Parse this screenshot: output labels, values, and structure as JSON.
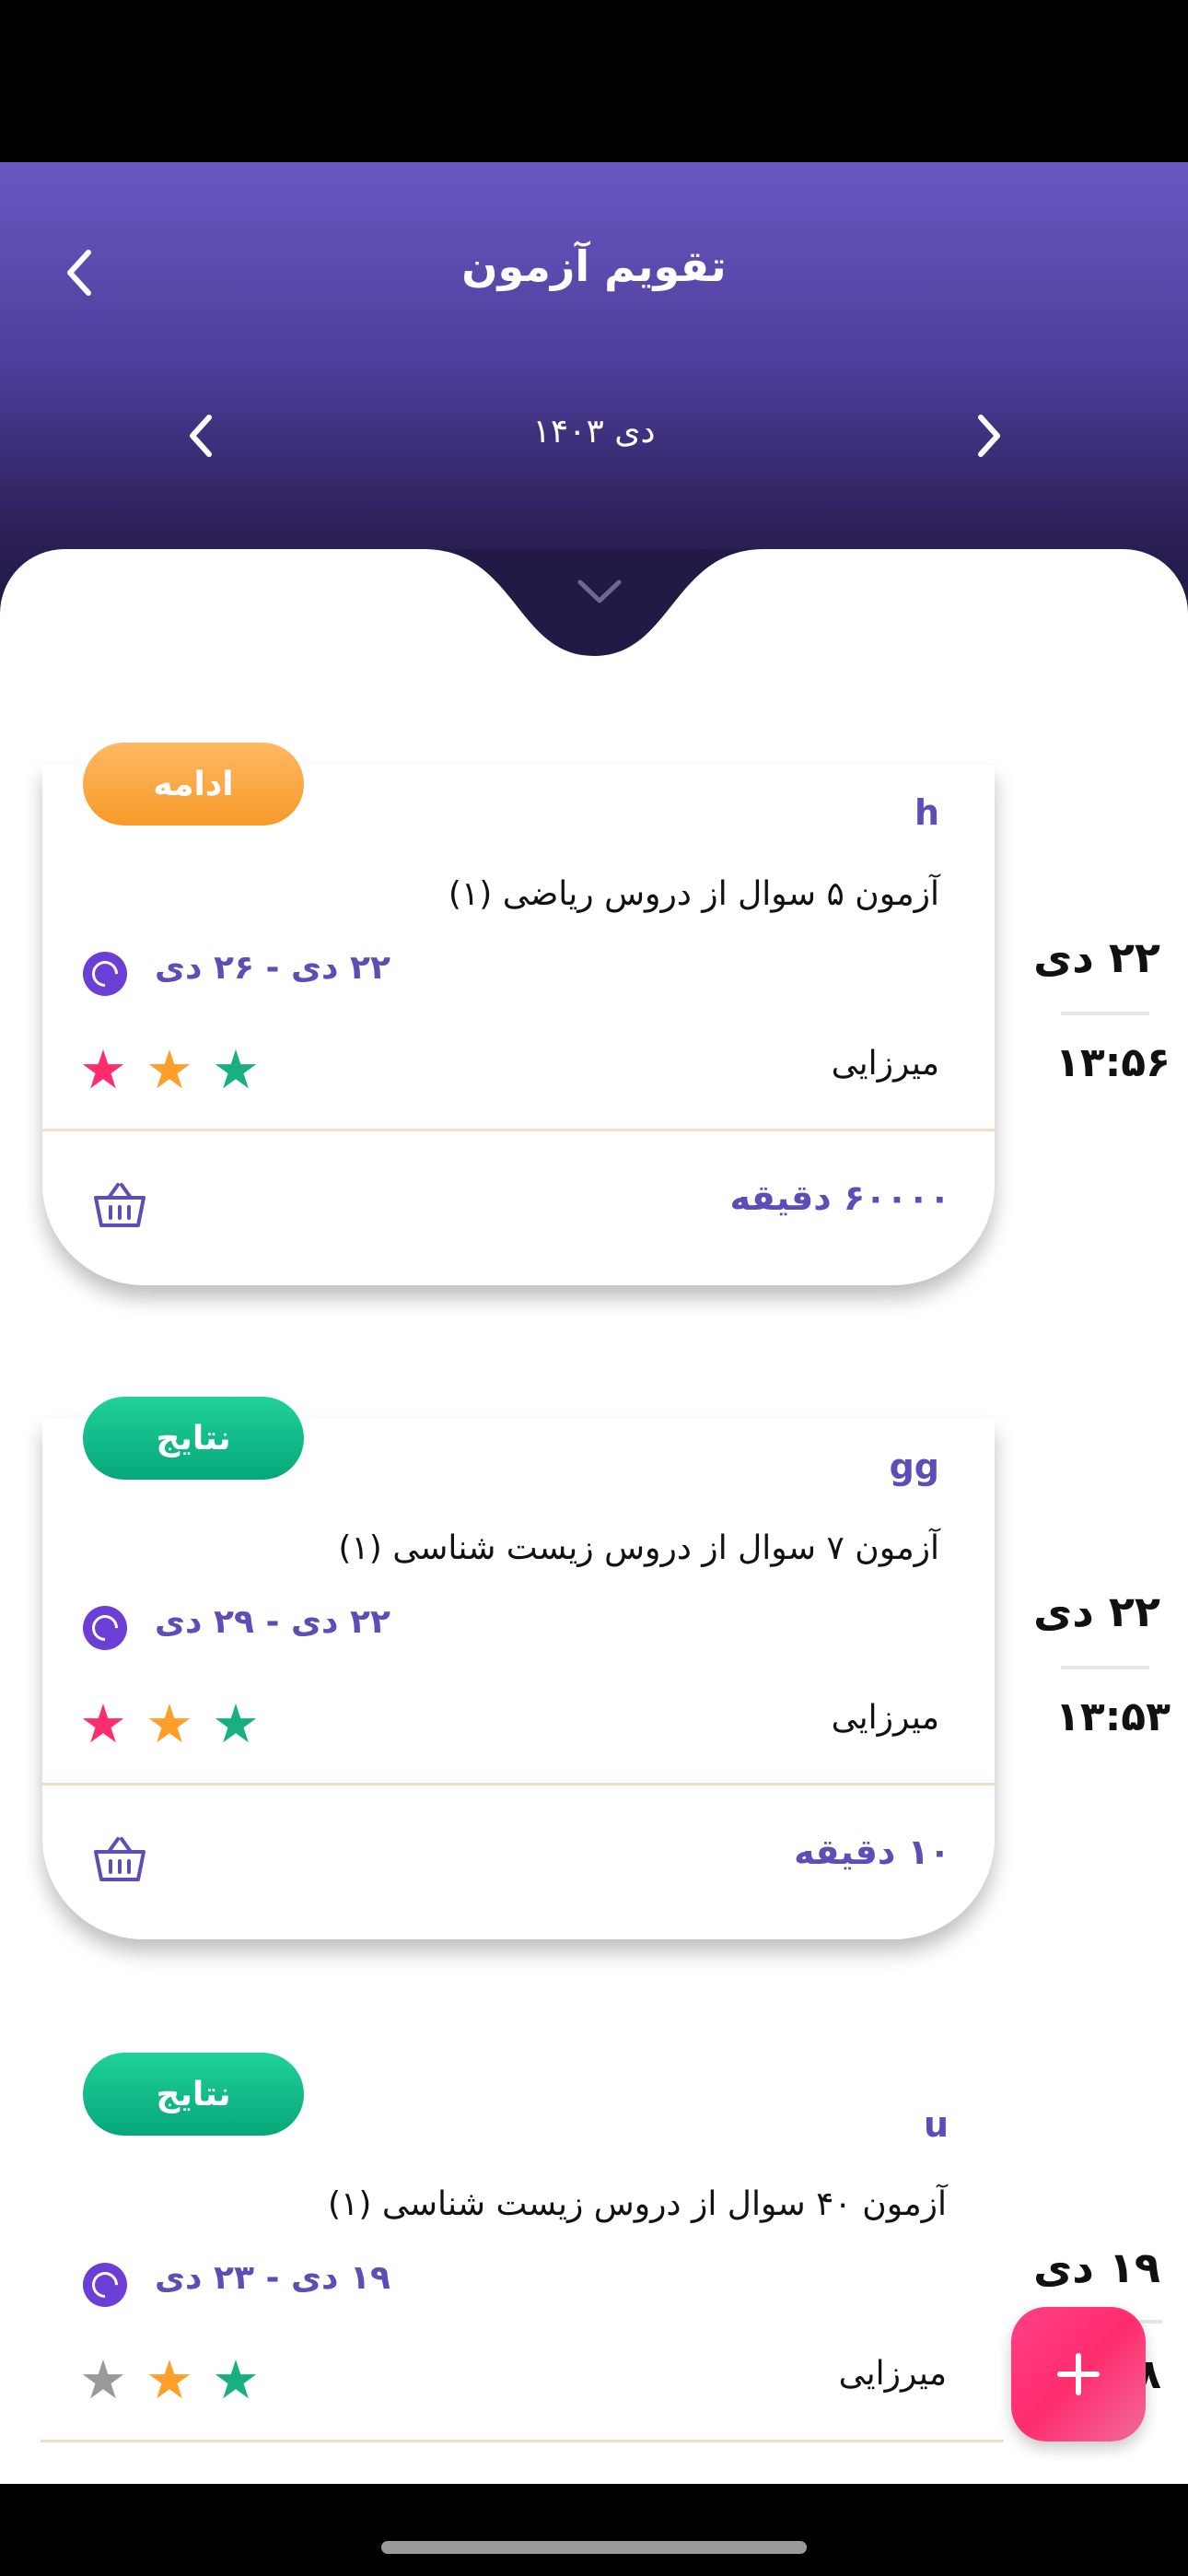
{
  "header": {
    "title": "تقویم آزمون",
    "month_label": "دی ۱۴۰۳"
  },
  "colors": {
    "accent": "#5c4db8",
    "header_top": "#6a57c2",
    "header_bottom": "#1b1536",
    "pill_orange": "#f79a2a",
    "pill_green": "#07a77a",
    "star_red": "#ff2d6e",
    "star_orange": "#ff9f2a",
    "star_green": "#17b07e",
    "star_gray": "#9a9a9a",
    "fab": "#ff3f86"
  },
  "exams": [
    {
      "status": "ادامه",
      "code": "h",
      "title": "آزمون ۵ سوال از دروس ریاضی (۱)",
      "date_range": "۲۲ دی - ۲۶ دی",
      "teacher": "میرزایی",
      "duration": "۶۰۰۰۰ دقیقه",
      "day": "۲۲ دی",
      "time": "۱۳:۵۶",
      "stars": [
        "red",
        "orange",
        "green"
      ]
    },
    {
      "status": "نتایج",
      "code": "gg",
      "title": "آزمون ۷ سوال از دروس زیست شناسی (۱)",
      "date_range": "۲۲ دی - ۲۹ دی",
      "teacher": "میرزایی",
      "duration": "۱۰ دقیقه",
      "day": "۲۲ دی",
      "time": "۱۳:۵۳",
      "stars": [
        "red",
        "orange",
        "green"
      ]
    },
    {
      "status": "نتایج",
      "code": "u",
      "title": "آزمون ۴۰ سوال از دروس زیست شناسی (۱)",
      "date_range": "۱۹ دی - ۲۳ دی",
      "teacher": "میرزایی",
      "day": "۱۹ دی",
      "time_visible": "۸",
      "stars": [
        "gray",
        "orange",
        "green"
      ]
    }
  ],
  "icons": {
    "back": "chevron-left-icon",
    "prev": "chevron-left-icon",
    "next": "chevron-right-icon",
    "collapse": "chevron-down-icon",
    "clock": "clock-icon",
    "basket": "basket-icon",
    "star": "star-icon",
    "add": "plus-icon"
  }
}
